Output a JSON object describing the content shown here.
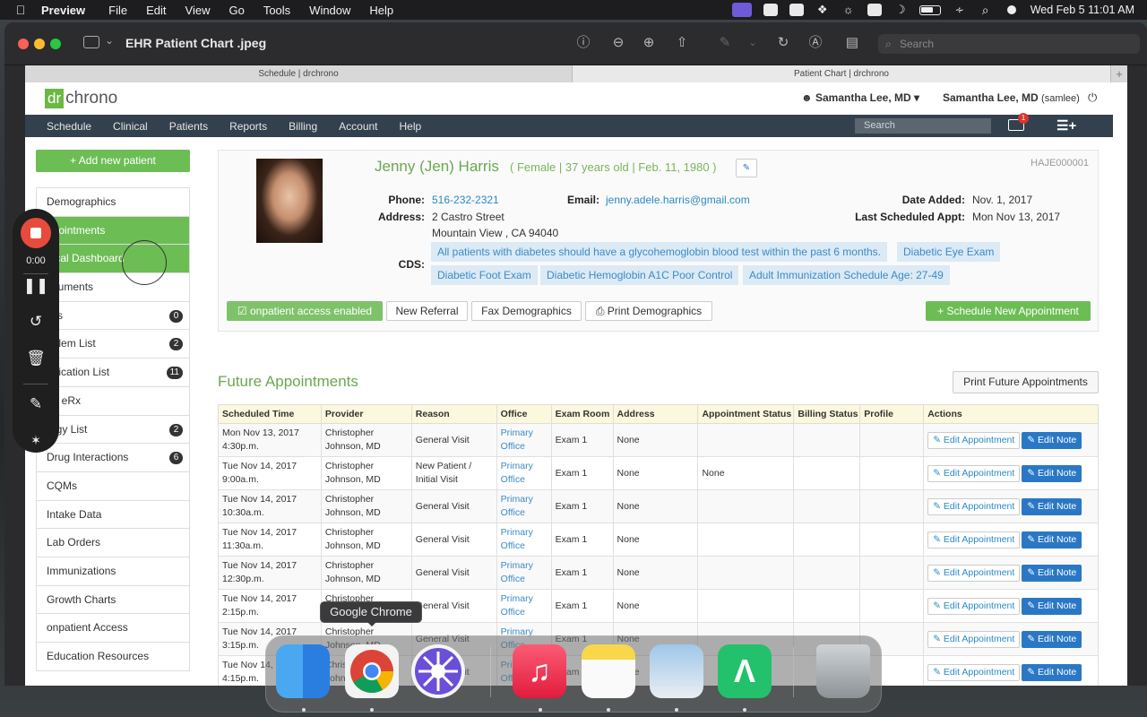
{
  "menubar": {
    "app": "Preview",
    "items": [
      "File",
      "Edit",
      "View",
      "Go",
      "Tools",
      "Window",
      "Help"
    ],
    "clock": "Wed Feb 5  11:01 AM"
  },
  "window": {
    "title": "EHR Patient Chart .jpeg",
    "search_placeholder": "Search"
  },
  "browser_tabs": [
    "Schedule | drchrono",
    "Patient Chart | drchrono"
  ],
  "header": {
    "logo_dr": "dr",
    "logo_chrono": "chrono",
    "user_menu": "Samantha Lee, MD",
    "user_name": "Samantha Lee, MD",
    "user_handle": "(samlee)"
  },
  "nav": {
    "items": [
      "Schedule",
      "Clinical",
      "Patients",
      "Reports",
      "Billing",
      "Account",
      "Help"
    ],
    "search_placeholder": "Search",
    "mail_badge": "1"
  },
  "sidebar": {
    "add_label": "+ Add new patient",
    "items": [
      {
        "label": "Demographics",
        "count": ""
      },
      {
        "label": "ppointments",
        "count": ""
      },
      {
        "label": "nical Dashboard",
        "count": ""
      },
      {
        "label": "ocuments",
        "count": ""
      },
      {
        "label": "sks",
        "count": "0"
      },
      {
        "label": "oblem List",
        "count": "2"
      },
      {
        "label": "edication List",
        "count": "11"
      },
      {
        "label": "nd eRx",
        "count": ""
      },
      {
        "label": "ergy List",
        "count": "2"
      },
      {
        "label": "Drug Interactions",
        "count": "6"
      },
      {
        "label": "CQMs",
        "count": ""
      },
      {
        "label": "Intake Data",
        "count": ""
      },
      {
        "label": "Lab Orders",
        "count": ""
      },
      {
        "label": "Immunizations",
        "count": ""
      },
      {
        "label": "Growth Charts",
        "count": ""
      },
      {
        "label": "onpatient Access",
        "count": ""
      },
      {
        "label": "Education Resources",
        "count": ""
      }
    ]
  },
  "patient": {
    "name": "Jenny (Jen) Harris",
    "info": "( Female | 37 years old | Feb. 11, 1980 )",
    "id": "HAJE000001",
    "phone_label": "Phone:",
    "phone": "516-232-2321",
    "address_label": "Address:",
    "address1": "2 Castro Street",
    "address2": "Mountain View , CA 94040",
    "email_label": "Email:",
    "email": "jenny.adele.harris@gmail.com",
    "date_added_label": "Date Added:",
    "date_added": "Nov. 1, 2017",
    "last_appt_label": "Last Scheduled Appt:",
    "last_appt": "Mon Nov 13, 2017",
    "cds_label": "CDS:",
    "cds": [
      "All patients with diabetes should have a glycohemoglobin blood test within the past 6 months.",
      "Diabetic Eye Exam",
      "Diabetic Foot Exam",
      "Diabetic Hemoglobin A1C Poor Control",
      "Adult Immunization Schedule Age: 27-49"
    ],
    "buttons": {
      "access": "☑ onpatient access enabled",
      "referral": "New Referral",
      "fax": "Fax Demographics",
      "print": "⎙ Print Demographics",
      "schedule": "+ Schedule New Appointment"
    }
  },
  "future": {
    "title": "Future Appointments",
    "print_label": "Print Future Appointments",
    "columns": [
      "Scheduled Time",
      "Provider",
      "Reason",
      "Office",
      "Exam Room",
      "Address",
      "Appointment Status",
      "Billing Status",
      "Profile",
      "Actions"
    ],
    "edit_appt": "✎ Edit Appointment",
    "edit_note": "✎ Edit Note",
    "rows": [
      {
        "time1": "Mon Nov 13, 2017",
        "time2": "4:30p.m.",
        "prov1": "Christopher",
        "prov2": "Johnson, MD",
        "reason1": "General Visit",
        "reason2": "",
        "office1": "Primary",
        "office2": "Office",
        "room": "Exam 1",
        "addr": "None",
        "status": ""
      },
      {
        "time1": "Tue Nov 14, 2017",
        "time2": "9:00a.m.",
        "prov1": "Christopher",
        "prov2": "Johnson, MD",
        "reason1": "New Patient /",
        "reason2": "Initial Visit",
        "office1": "Primary",
        "office2": "Office",
        "room": "Exam 1",
        "addr": "None",
        "status": "None"
      },
      {
        "time1": "Tue Nov 14, 2017",
        "time2": "10:30a.m.",
        "prov1": "Christopher",
        "prov2": "Johnson, MD",
        "reason1": "General Visit",
        "reason2": "",
        "office1": "Primary",
        "office2": "Office",
        "room": "Exam 1",
        "addr": "None",
        "status": ""
      },
      {
        "time1": "Tue Nov 14, 2017",
        "time2": "11:30a.m.",
        "prov1": "Christopher",
        "prov2": "Johnson, MD",
        "reason1": "General Visit",
        "reason2": "",
        "office1": "Primary",
        "office2": "Office",
        "room": "Exam 1",
        "addr": "None",
        "status": ""
      },
      {
        "time1": "Tue Nov 14, 2017",
        "time2": "12:30p.m.",
        "prov1": "Christopher",
        "prov2": "Johnson, MD",
        "reason1": "General Visit",
        "reason2": "",
        "office1": "Primary",
        "office2": "Office",
        "room": "Exam 1",
        "addr": "None",
        "status": ""
      },
      {
        "time1": "Tue Nov 14, 2017",
        "time2": "2:15p.m.",
        "prov1": "Christopher",
        "prov2": "Johnson, MD",
        "reason1": "General Visit",
        "reason2": "",
        "office1": "Primary",
        "office2": "Office",
        "room": "Exam 1",
        "addr": "None",
        "status": ""
      },
      {
        "time1": "Tue Nov 14, 2017",
        "time2": "3:15p.m.",
        "prov1": "Christopher",
        "prov2": "Johnson, MD",
        "reason1": "General Visit",
        "reason2": "",
        "office1": "Primary",
        "office2": "Office",
        "room": "Exam 1",
        "addr": "None",
        "status": ""
      },
      {
        "time1": "Tue Nov 14, 2017",
        "time2": "4:15p.m.",
        "prov1": "Christopher",
        "prov2": "Johnson, MD",
        "reason1": "General Visit",
        "reason2": "",
        "office1": "Primary",
        "office2": "Office",
        "room": "Exam 1",
        "addr": "None",
        "status": ""
      }
    ]
  },
  "recorder": {
    "time": "0:00"
  },
  "dock": {
    "tooltip": "Google Chrome"
  },
  "colors": {
    "accent_green": "#6cbd54",
    "nav": "#33404d",
    "link": "#2a8ac4",
    "record_red": "#e64b3c"
  }
}
